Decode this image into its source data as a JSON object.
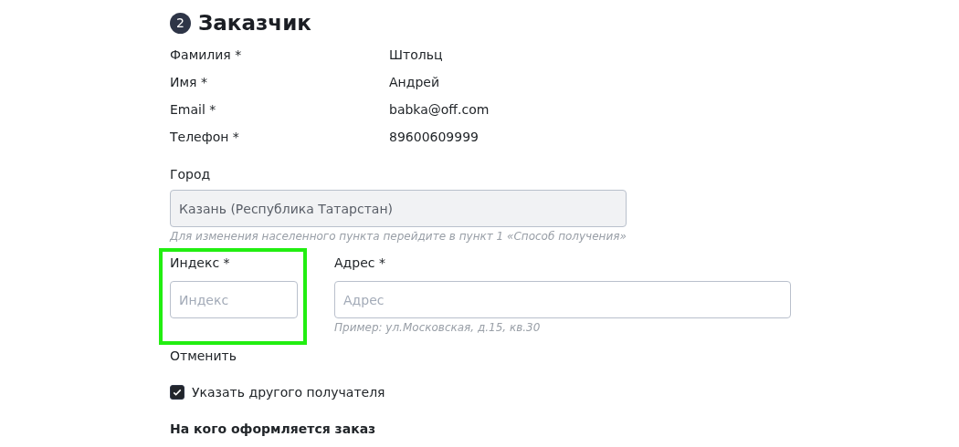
{
  "section": {
    "step": "2",
    "title": "Заказчик"
  },
  "customer": [
    {
      "label": "Фамилия *",
      "value": "Штольц"
    },
    {
      "label": "Имя *",
      "value": "Андрей"
    },
    {
      "label": "Email *",
      "value": "babka@off.com"
    },
    {
      "label": "Телефон *",
      "value": "89600609999"
    }
  ],
  "city": {
    "label": "Город",
    "value": "Казань (Республика Татарстан)",
    "disabled": true,
    "hint": "Для изменения населенного пункта перейдите в пункт 1 «Способ получения»"
  },
  "index": {
    "label": "Индекс *",
    "placeholder": "Индекс",
    "highlighted": true
  },
  "address": {
    "label": "Адрес *",
    "placeholder": "Адрес",
    "hint": "Пример: ул.Московская, д.15, кв.30"
  },
  "cancel": "Отменить",
  "other_recipient": {
    "label": "Указать другого получателя",
    "checked": true
  },
  "recipient_heading": "На кого оформляется заказ"
}
